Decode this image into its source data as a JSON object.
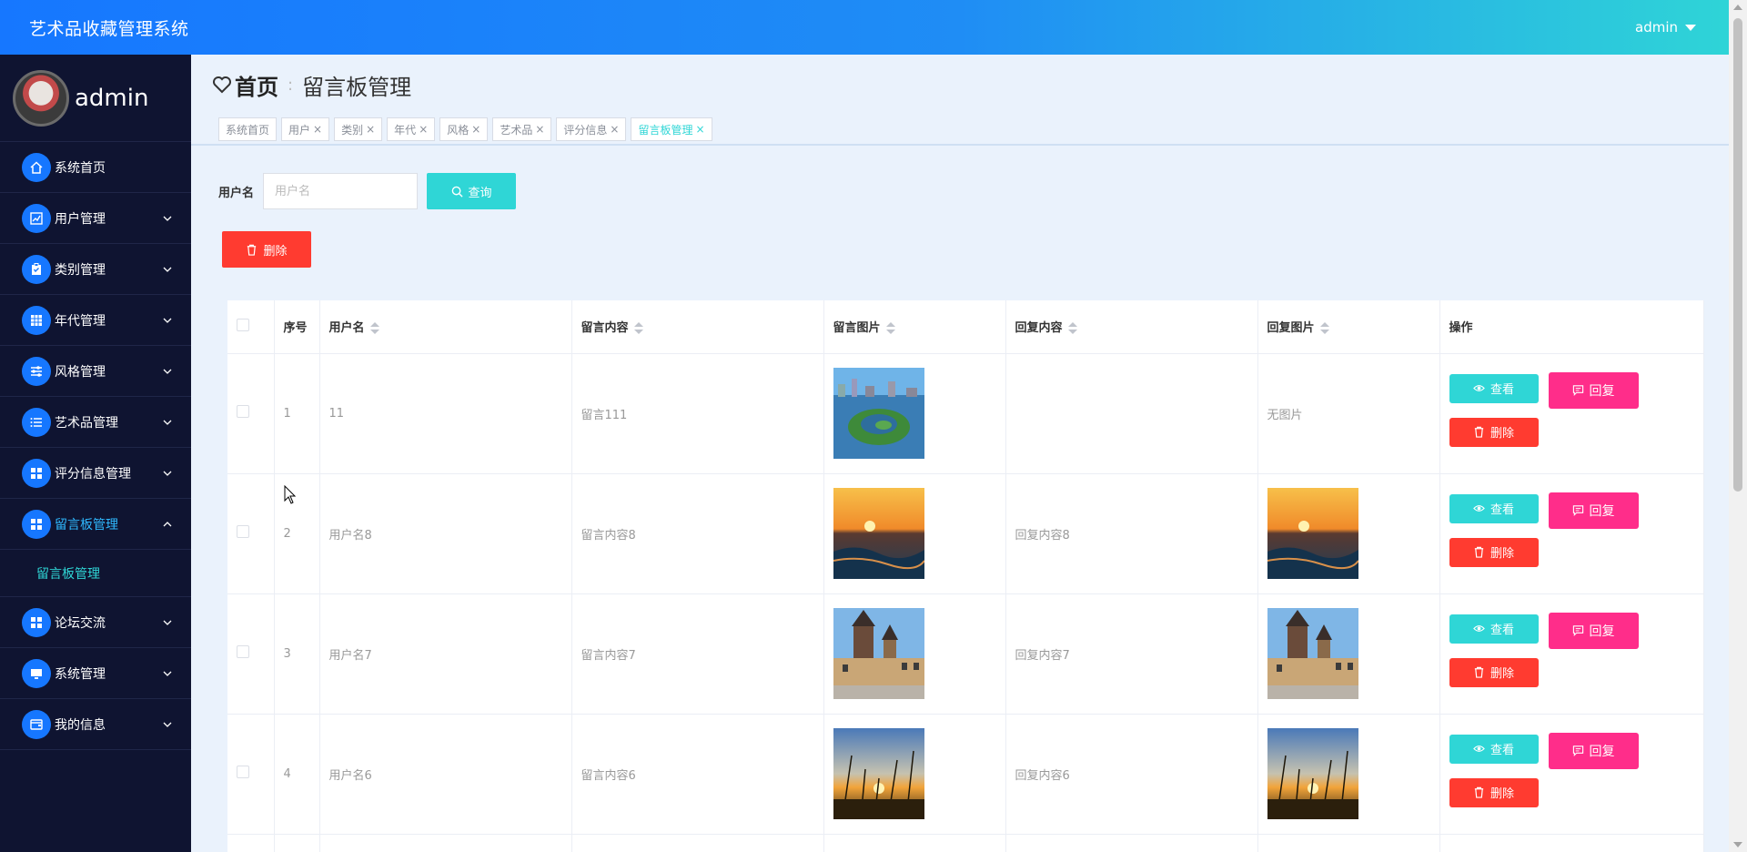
{
  "header": {
    "app_title": "艺术品收藏管理系统",
    "user": "admin"
  },
  "sidebar": {
    "username": "admin",
    "items": [
      {
        "label": "系统首页",
        "icon": "home-icon"
      },
      {
        "label": "用户管理",
        "icon": "chart-icon"
      },
      {
        "label": "类别管理",
        "icon": "clipboard-icon"
      },
      {
        "label": "年代管理",
        "icon": "grid-icon"
      },
      {
        "label": "风格管理",
        "icon": "sliders-icon"
      },
      {
        "label": "艺术品管理",
        "icon": "list-icon"
      },
      {
        "label": "评分信息管理",
        "icon": "apps-icon"
      },
      {
        "label": "留言板管理",
        "icon": "apps-icon"
      },
      {
        "label": "论坛交流",
        "icon": "apps-icon"
      },
      {
        "label": "系统管理",
        "icon": "monitor-icon"
      },
      {
        "label": "我的信息",
        "icon": "wallet-icon"
      }
    ],
    "submenu": {
      "label": "留言板管理"
    }
  },
  "breadcrumb": {
    "home": "首页",
    "current": "留言板管理"
  },
  "tags": [
    {
      "label": "系统首页",
      "closable": false
    },
    {
      "label": "用户",
      "closable": true
    },
    {
      "label": "类别",
      "closable": true
    },
    {
      "label": "年代",
      "closable": true
    },
    {
      "label": "风格",
      "closable": true
    },
    {
      "label": "艺术品",
      "closable": true
    },
    {
      "label": "评分信息",
      "closable": true
    },
    {
      "label": "留言板管理",
      "closable": true
    }
  ],
  "search": {
    "label": "用户名",
    "placeholder": "用户名",
    "value": "",
    "button": "查询"
  },
  "toolbar": {
    "delete_label": "删除"
  },
  "table": {
    "headers": {
      "index": "序号",
      "username": "用户名",
      "content": "留言内容",
      "image": "留言图片",
      "reply": "回复内容",
      "reply_image": "回复图片",
      "ops": "操作"
    },
    "rows": [
      {
        "index": "1",
        "username": "11",
        "content": "留言111",
        "image": "lake-island-photo",
        "reply": "",
        "reply_image_text": "无图片",
        "reply_image": ""
      },
      {
        "index": "2",
        "username": "用户名8",
        "content": "留言内容8",
        "image": "sunset-sea-photo",
        "reply": "回复内容8",
        "reply_image_text": "",
        "reply_image": "sunset-sea-photo"
      },
      {
        "index": "3",
        "username": "用户名7",
        "content": "留言内容7",
        "image": "prague-tower-photo",
        "reply": "回复内容7",
        "reply_image_text": "",
        "reply_image": "prague-tower-photo"
      },
      {
        "index": "4",
        "username": "用户名6",
        "content": "留言内容6",
        "image": "wheat-sunset-photo",
        "reply": "回复内容6",
        "reply_image_text": "",
        "reply_image": "wheat-sunset-photo"
      }
    ],
    "actions": {
      "view": "查看",
      "reply": "回复",
      "delete": "删除"
    }
  },
  "colors": {
    "accent": "#1677ff",
    "cyan": "#2fd6d6",
    "danger": "#ff3b30",
    "pink": "#ff2d8a",
    "sidebar_bg": "#0f1431"
  }
}
